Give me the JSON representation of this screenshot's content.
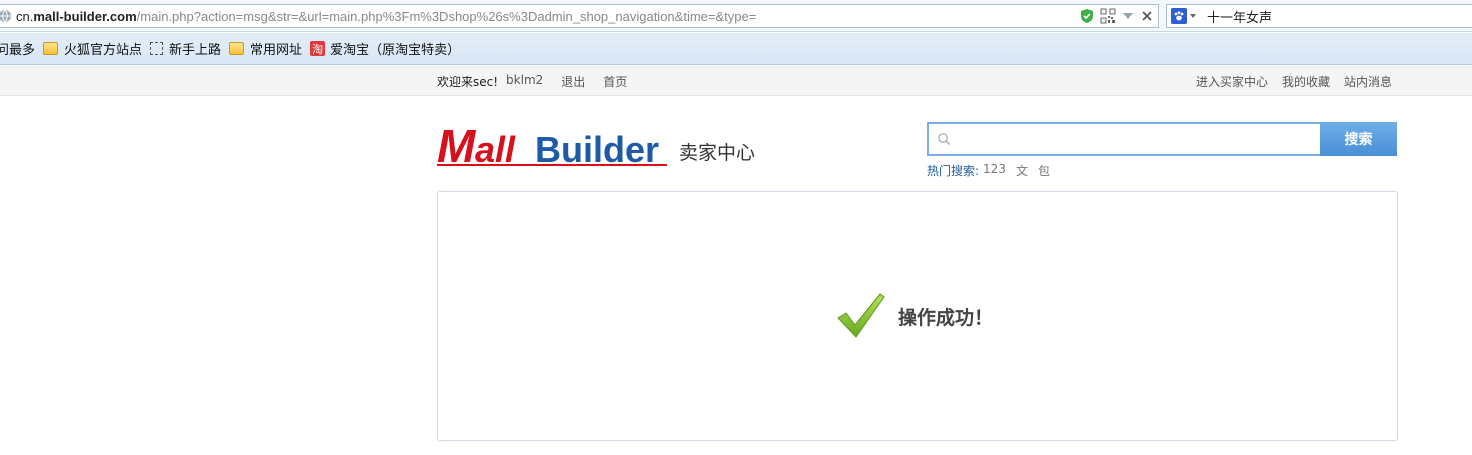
{
  "browser": {
    "url": {
      "prefix": "cn.",
      "host": "mall-builder.com",
      "path": "/main.php?action=msg&str=&url=main.php%3Fm%3Dshop%26s%3Dadmin_shop_navigation&time=&type="
    },
    "search_query": "十一年女声",
    "icons": [
      "globe-icon",
      "shield-icon",
      "qr-icon",
      "dropdown-arrow-icon",
      "close-icon",
      "baidu-paw-icon"
    ],
    "bookmarks": [
      {
        "label": "问最多",
        "icon": "none"
      },
      {
        "label": "火狐官方站点",
        "icon": "folder-icon"
      },
      {
        "label": "新手上路",
        "icon": "dashed-box-icon"
      },
      {
        "label": "常用网址",
        "icon": "folder-icon"
      },
      {
        "label": "爱淘宝（原淘宝特卖）",
        "icon": "taobao-icon"
      }
    ],
    "taobao_glyph": "淘"
  },
  "topbar": {
    "welcome": "欢迎来sec!",
    "user": "bklm2",
    "logout": "退出",
    "home": "首页",
    "right_links": [
      "进入买家中心",
      "我的收藏",
      "站内消息"
    ]
  },
  "header": {
    "logo_text_m": "M",
    "logo_text_all": "all",
    "logo_text_builder": "Builder",
    "center_title": "卖家中心",
    "search_button": "搜索",
    "search_placeholder": "",
    "hot_label": "热门搜索:",
    "hot_keywords": [
      "123",
      "文",
      "包"
    ]
  },
  "message": {
    "text": "操作成功！"
  },
  "colors": {
    "logo_red": "#d7101c",
    "logo_blue": "#1e5aa8",
    "search_button": "#4a8fd6",
    "check_green": "#8cc63f"
  }
}
